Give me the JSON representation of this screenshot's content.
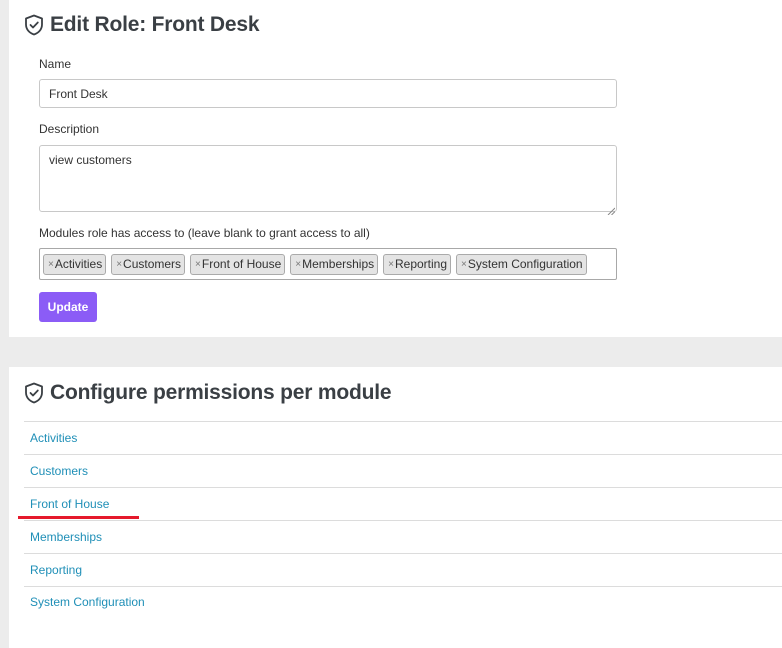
{
  "edit_role": {
    "title": "Edit Role: Front Desk",
    "name_label": "Name",
    "name_value": "Front Desk",
    "description_label": "Description",
    "description_value": "view customers",
    "modules_label": "Modules role has access to (leave blank to grant access to all)",
    "modules_chips": [
      "Activities",
      "Customers",
      "Front of House",
      "Memberships",
      "Reporting",
      "System Configuration"
    ],
    "chip_remove_symbol": "×",
    "update_label": "Update",
    "button_color": "#8b5cf6"
  },
  "permissions": {
    "title": "Configure permissions per module",
    "modules": [
      "Activities",
      "Customers",
      "Front of House",
      "Memberships",
      "Reporting",
      "System Configuration"
    ],
    "link_color": "#1f8fb7",
    "highlighted_module": "Front of House",
    "highlight_color": "#e5192c"
  },
  "icons": {
    "title_icon": "shield-check-icon"
  }
}
